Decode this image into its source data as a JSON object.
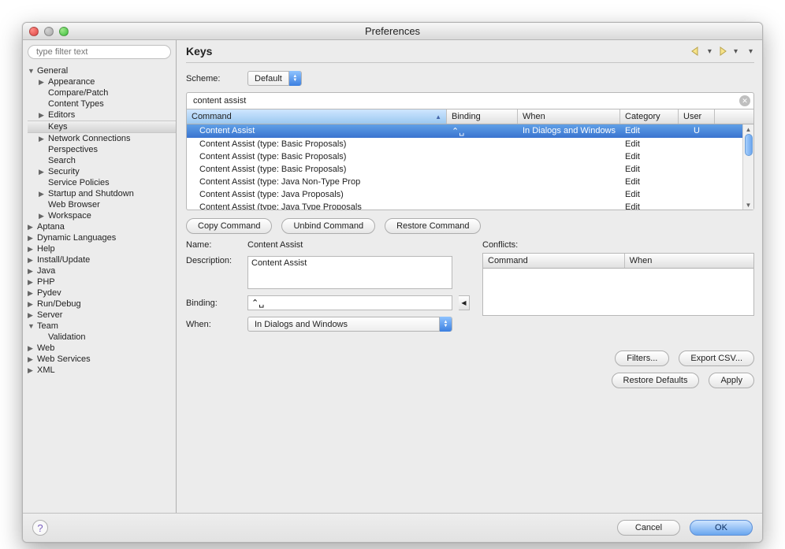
{
  "window": {
    "title": "Preferences"
  },
  "filter": {
    "placeholder": "type filter text"
  },
  "tree": [
    {
      "label": "General",
      "expanded": true,
      "level": 0,
      "children": [
        {
          "label": "Appearance",
          "hasChildren": true,
          "level": 1
        },
        {
          "label": "Compare/Patch",
          "hasChildren": false,
          "level": 1
        },
        {
          "label": "Content Types",
          "hasChildren": false,
          "level": 1
        },
        {
          "label": "Editors",
          "hasChildren": true,
          "level": 1
        },
        {
          "label": "Keys",
          "hasChildren": false,
          "level": 1,
          "selected": true
        },
        {
          "label": "Network Connections",
          "hasChildren": true,
          "level": 1
        },
        {
          "label": "Perspectives",
          "hasChildren": false,
          "level": 1
        },
        {
          "label": "Search",
          "hasChildren": false,
          "level": 1
        },
        {
          "label": "Security",
          "hasChildren": true,
          "level": 1
        },
        {
          "label": "Service Policies",
          "hasChildren": false,
          "level": 1
        },
        {
          "label": "Startup and Shutdown",
          "hasChildren": true,
          "level": 1
        },
        {
          "label": "Web Browser",
          "hasChildren": false,
          "level": 1
        },
        {
          "label": "Workspace",
          "hasChildren": true,
          "level": 1
        }
      ]
    },
    {
      "label": "Aptana",
      "hasChildren": true,
      "level": 0
    },
    {
      "label": "Dynamic Languages",
      "hasChildren": true,
      "level": 0
    },
    {
      "label": "Help",
      "hasChildren": true,
      "level": 0
    },
    {
      "label": "Install/Update",
      "hasChildren": true,
      "level": 0
    },
    {
      "label": "Java",
      "hasChildren": true,
      "level": 0
    },
    {
      "label": "PHP",
      "hasChildren": true,
      "level": 0
    },
    {
      "label": "Pydev",
      "hasChildren": true,
      "level": 0
    },
    {
      "label": "Run/Debug",
      "hasChildren": true,
      "level": 0
    },
    {
      "label": "Server",
      "hasChildren": true,
      "level": 0
    },
    {
      "label": "Team",
      "hasChildren": true,
      "level": 0,
      "expanded": true,
      "children": [
        {
          "label": "Validation",
          "hasChildren": false,
          "level": 1
        }
      ]
    },
    {
      "label": "Web",
      "hasChildren": true,
      "level": 0
    },
    {
      "label": "Web Services",
      "hasChildren": true,
      "level": 0
    },
    {
      "label": "XML",
      "hasChildren": true,
      "level": 0
    }
  ],
  "page": {
    "title": "Keys",
    "scheme_label": "Scheme:",
    "scheme_value": "Default",
    "search_value": "content assist",
    "columns": {
      "command": "Command",
      "binding": "Binding",
      "when": "When",
      "category": "Category",
      "user": "User"
    },
    "rows": [
      {
        "command": "Content Assist",
        "binding": "⌃␣",
        "when": "In Dialogs and Windows",
        "category": "Edit",
        "user": "U",
        "selected": true
      },
      {
        "command": "Content Assist (type: Basic Proposals)",
        "binding": "",
        "when": "",
        "category": "Edit",
        "user": ""
      },
      {
        "command": "Content Assist (type: Basic Proposals)",
        "binding": "",
        "when": "",
        "category": "Edit",
        "user": ""
      },
      {
        "command": "Content Assist (type: Basic Proposals)",
        "binding": "",
        "when": "",
        "category": "Edit",
        "user": ""
      },
      {
        "command": "Content Assist (type: Java Non-Type Prop",
        "binding": "",
        "when": "",
        "category": "Edit",
        "user": ""
      },
      {
        "command": "Content Assist (type: Java Proposals)",
        "binding": "",
        "when": "",
        "category": "Edit",
        "user": ""
      },
      {
        "command": "Content Assist (type: Java Type Proposals",
        "binding": "",
        "when": "",
        "category": "Edit",
        "user": ""
      }
    ],
    "copy_btn": "Copy Command",
    "unbind_btn": "Unbind Command",
    "restore_btn": "Restore Command",
    "name_label": "Name:",
    "name_value": "Content Assist",
    "desc_label": "Description:",
    "desc_value": "Content Assist",
    "binding_label": "Binding:",
    "binding_value": "⌃␣",
    "when_label": "When:",
    "when_value": "In Dialogs and Windows",
    "conflicts_label": "Conflicts:",
    "conflicts_cols": {
      "command": "Command",
      "when": "When"
    },
    "filters_btn": "Filters...",
    "export_btn": "Export CSV...",
    "restore_defaults_btn": "Restore Defaults",
    "apply_btn": "Apply"
  },
  "footer": {
    "cancel": "Cancel",
    "ok": "OK"
  }
}
